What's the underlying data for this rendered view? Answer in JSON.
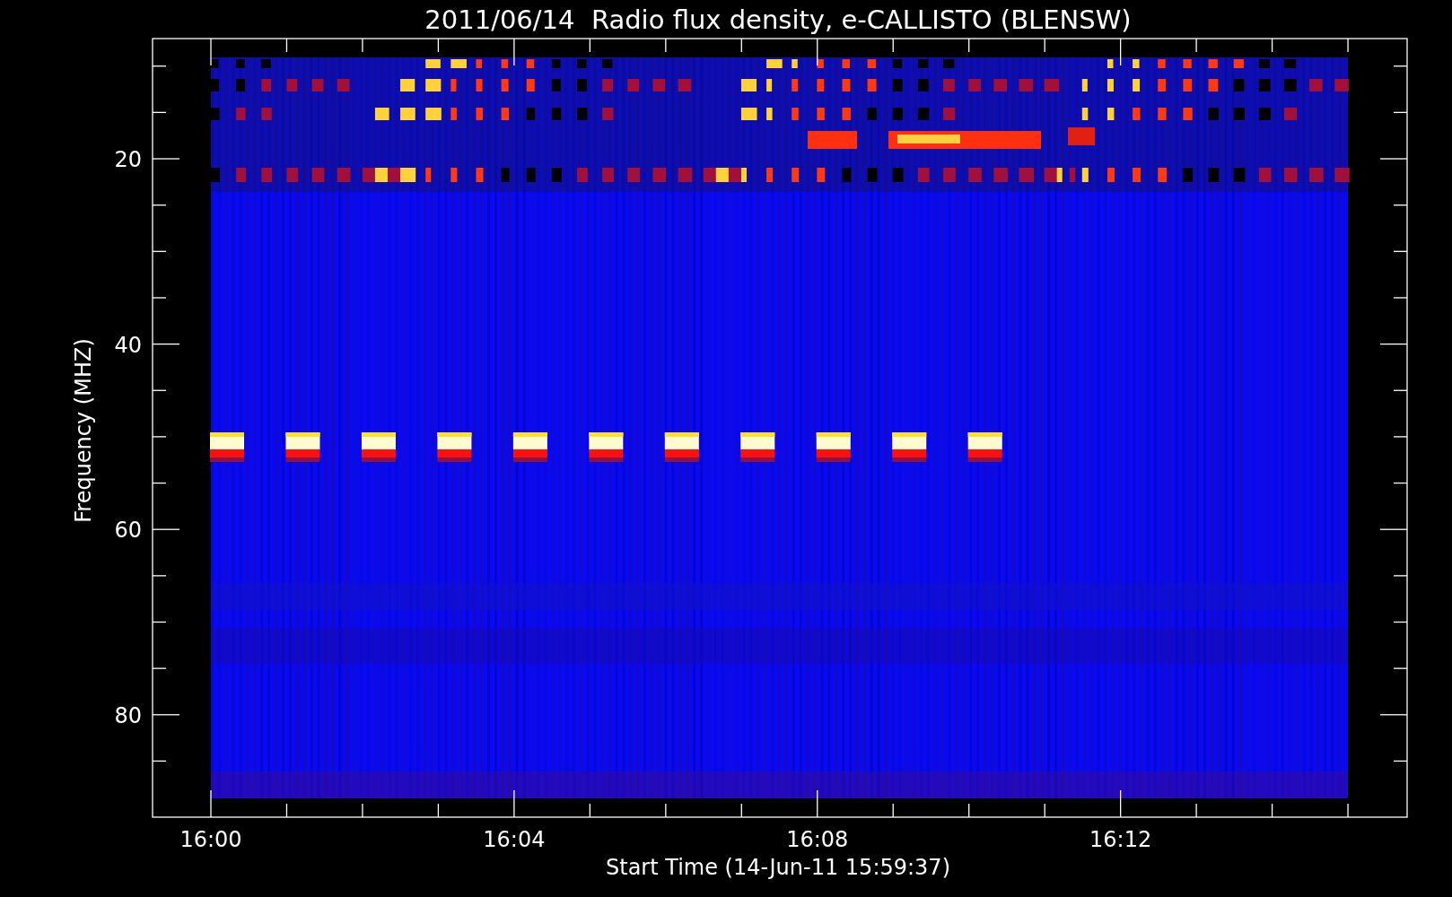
{
  "title": "2011/06/14  Radio flux density, e-CALLISTO (BLENSW)",
  "xlabel": "Start Time (14-Jun-11 15:59:37)",
  "ylabel": "Frequency (MHZ)",
  "yticks": [
    "20",
    "40",
    "60",
    "80"
  ],
  "xticks": [
    "16:00",
    "16:04",
    "16:08",
    "16:12"
  ]
}
